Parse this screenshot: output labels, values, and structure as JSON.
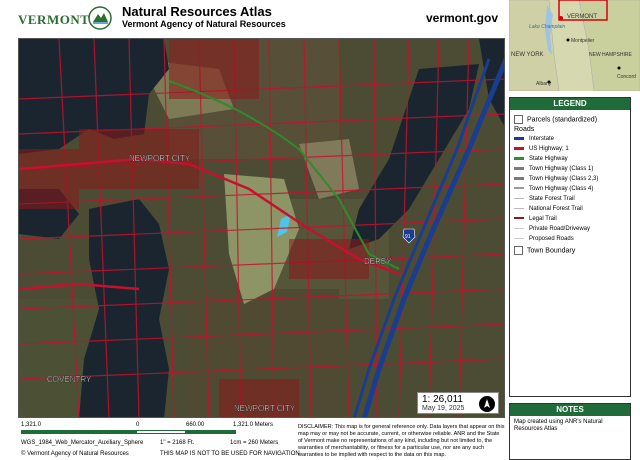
{
  "header": {
    "logo_text": "VERMONT",
    "title": "Natural Resources Atlas",
    "subtitle": "Vermont Agency of Natural Resources",
    "site_url": "vermont.gov"
  },
  "map": {
    "labels": {
      "newport_city_north": "NEWPORT CITY",
      "derby": "DERBY",
      "coventry": "COVENTRY",
      "newport_city_south": "NEWPORT CITY",
      "interstate_shield": "91"
    },
    "scale_ratio": "1: 26,011",
    "date": "May 19, 2025",
    "north_arrow_icon": "north-arrow-icon"
  },
  "locator": {
    "labels": [
      "VERMONT",
      "Lake Champlain",
      "Montpelier",
      "NEW YORK",
      "NEW HAMPSHIRE",
      "Albany",
      "Concord"
    ]
  },
  "legend": {
    "title": "LEGEND",
    "items": [
      {
        "label": "Parcels (standardized)",
        "kind": "box",
        "color": "#ffffff"
      },
      {
        "label": "Roads",
        "kind": "heading",
        "color": ""
      },
      {
        "label": "Interstate",
        "kind": "line",
        "color": "#1a3d8f"
      },
      {
        "label": "US Highway; 1",
        "kind": "line",
        "color": "#c8102e"
      },
      {
        "label": "State Highway",
        "kind": "line",
        "color": "#2e8b2e"
      },
      {
        "label": "Town Highway (Class 1)",
        "kind": "line",
        "color": "#7a7a7a"
      },
      {
        "label": "Town Highway (Class 2,3)",
        "kind": "line",
        "color": "#7a7a7a"
      },
      {
        "label": "Town Highway (Class 4)",
        "kind": "line",
        "color": "#9a9a9a"
      },
      {
        "label": "State Forest Trail",
        "kind": "line",
        "color": "#bbbbbb"
      },
      {
        "label": "National Forest Trail",
        "kind": "line",
        "color": "#bbbbbb"
      },
      {
        "label": "Legal Trail",
        "kind": "line",
        "color": "#8b1a1a"
      },
      {
        "label": "Private Road/Driveway",
        "kind": "line",
        "color": "#cccccc"
      },
      {
        "label": "Proposed Roads",
        "kind": "line",
        "color": "#cccccc"
      },
      {
        "label": "Town Boundary",
        "kind": "box",
        "color": "#ffffff"
      }
    ]
  },
  "notes": {
    "title": "NOTES",
    "text": "Map created using ANR's Natural Resources Atlas"
  },
  "footer": {
    "scale_left": "1,321.0",
    "scale_zero": "0",
    "scale_mid": "660.00",
    "scale_right": "1,321.0 Meters",
    "projection": "WGS_1984_Web_Mercator_Auxiliary_Sphere",
    "inch_ft": "1\" =     2168   Ft.",
    "cm_m": "1cm =     260   Meters",
    "copyright": "© Vermont Agency of Natural Resources",
    "navigation_warning": "THIS MAP IS NOT TO BE USED FOR NAVIGATION",
    "disclaimer": "DISCLAIMER: This map is for general reference only. Data layers that appear on this map may or may not be accurate, current, or otherwise reliable. ANR and the State of Vermont make no representations of any kind, including but not limited to, the warranties of merchantability, or fitness for a particular use, nor are any such warranties to be implied with respect to the data on this map."
  },
  "colors": {
    "brand_green": "#1f6b3a",
    "parcel_red": "#c8102e",
    "interstate_blue": "#1a3d8f",
    "water": "#1b2530",
    "forest": "#3f4a2c"
  }
}
